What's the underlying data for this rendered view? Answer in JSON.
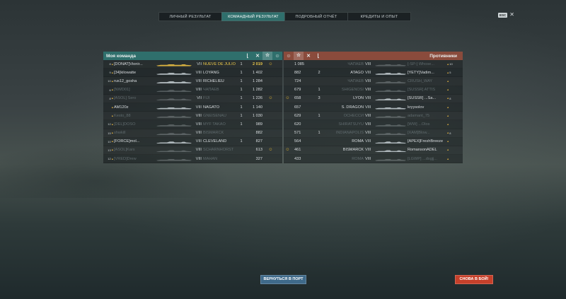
{
  "tabs": [
    "ЛИЧНЫЙ РЕЗУЛЬТАТ",
    "КОМАНДНЫЙ РЕЗУЛЬТАТ",
    "ПОДРОБНЫЙ ОТЧЁТ",
    "КРЕДИТЫ И ОПЫТ"
  ],
  "active_tab": 1,
  "esc_label": "ESC",
  "close_glyph": "✕",
  "ally_header": "Моя команда",
  "enemy_header": "Противники",
  "header_icons": {
    "kills": "✕",
    "xp": "☆",
    "medal": "☺",
    "sort": "⌊"
  },
  "ally_rows": [
    {
      "lvl": "8",
      "player": "[DONAT]Vionir...",
      "tier": "VII",
      "ship": "NUEVE DE JULIO",
      "kills": "1",
      "xp": "2 019",
      "medal": "☺",
      "dead": false,
      "highlight": true
    },
    {
      "lvl": "9",
      "player": "[34]kilowatte",
      "tier": "VIII",
      "ship": "LOYANG",
      "kills": "1",
      "xp": "1 402",
      "medal": "",
      "dead": false,
      "highlight": false
    },
    {
      "lvl": "10",
      "player": "rus12_gosha",
      "tier": "VIII",
      "ship": "RICHELIEU",
      "kills": "1",
      "xp": "1 284",
      "medal": "",
      "dead": false,
      "highlight": false
    },
    {
      "lvl": "6",
      "player": "[NWD01]",
      "tier": "VIII",
      "ship": "ЧАПАЕВ",
      "kills": "1",
      "xp": "1 282",
      "medal": "",
      "dead": true,
      "highlight": false
    },
    {
      "lvl": "8",
      "player": "[ASOL] Sero",
      "tier": "VII",
      "ship": "FIJI",
      "kills": "1",
      "xp": "1 226",
      "medal": "☺",
      "dead": true,
      "highlight": false
    },
    {
      "lvl": "",
      "player": "AM120z",
      "tier": "VIII",
      "ship": "NAGATO",
      "kills": "1",
      "xp": "1 140",
      "medal": "",
      "dead": false,
      "highlight": false
    },
    {
      "lvl": "",
      "player": "Kesto_88",
      "tier": "VIII",
      "ship": "GNEISENAU",
      "kills": "1",
      "xp": "1 030",
      "medal": "",
      "dead": true,
      "highlight": false
    },
    {
      "lvl": "12",
      "player": "[DEL]DOSO",
      "tier": "VIII",
      "ship": "MYF TAKAO",
      "kills": "1",
      "xp": "989",
      "medal": "",
      "dead": true,
      "highlight": false
    },
    {
      "lvl": "15",
      "player": "shwkill",
      "tier": "VIII",
      "ship": "BISMARCK",
      "kills": "",
      "xp": "882",
      "medal": "",
      "dead": true,
      "highlight": false
    },
    {
      "lvl": "10",
      "player": "[FORCE]mol...",
      "tier": "VIII",
      "ship": "CLEVELAND",
      "kills": "1",
      "xp": "827",
      "medal": "",
      "dead": false,
      "highlight": false
    },
    {
      "lvl": "13",
      "player": "[ASOL]Kars",
      "tier": "VIII",
      "ship": "SCHARNHORST",
      "kills": "",
      "xp": "613",
      "medal": "☺",
      "dead": true,
      "highlight": false
    },
    {
      "lvl": "12",
      "player": "[VRED]Drew",
      "tier": "VIII",
      "ship": "MAHAN",
      "kills": "",
      "xp": "327",
      "medal": "",
      "dead": true,
      "highlight": false
    }
  ],
  "enemy_rows": [
    {
      "medal": "",
      "xp": "1 085",
      "kills": "",
      "ship": "ЧАПАЕВ",
      "tier": "VIII",
      "player": "[-SP-] Whose...",
      "lvl": "10",
      "dead": true
    },
    {
      "medal": "",
      "xp": "882",
      "kills": "2",
      "ship": "ATAGO",
      "tier": "VIII",
      "player": "[YETY]Vadim...",
      "lvl": "5",
      "dead": false
    },
    {
      "medal": "",
      "xp": "724",
      "kills": "",
      "ship": "ЧАПАЕВ",
      "tier": "VIII",
      "player": "CRUSH_WAY",
      "lvl": "",
      "dead": true
    },
    {
      "medal": "",
      "xp": "679",
      "kills": "1",
      "ship": "SHIGENOSI",
      "tier": "VIII",
      "player": "[SUSSR] ATTIS",
      "lvl": "",
      "dead": true
    },
    {
      "medal": "☺",
      "xp": "658",
      "kills": "3",
      "ship": "LYON",
      "tier": "VIII",
      "player": "[SUSSR] ...Sa...",
      "lvl": "8",
      "dead": false
    },
    {
      "medal": "",
      "xp": "657",
      "kills": "",
      "ship": "S. DRAGON",
      "tier": "VIII",
      "player": "kryysolov",
      "lvl": "",
      "dead": false
    },
    {
      "medal": "",
      "xp": "629",
      "kills": "1",
      "ship": "ОСНЕССИ",
      "tier": "VIII",
      "player": "adamant_75",
      "lvl": "",
      "dead": true
    },
    {
      "medal": "",
      "xp": "620",
      "kills": "",
      "ship": "SHIRATSUYU",
      "tier": "VIII",
      "player": "[WW] ...Olos",
      "lvl": "",
      "dead": true
    },
    {
      "medal": "",
      "xp": "571",
      "kills": "1",
      "ship": "INDIANAPOLIS",
      "tier": "VIII",
      "player": "[XAM]Blow...",
      "lvl": "8",
      "dead": true
    },
    {
      "medal": "",
      "xp": "564",
      "kills": "",
      "ship": "ROMA",
      "tier": "VIII",
      "player": "[APEX]FreshBreeze",
      "lvl": "",
      "dead": false
    },
    {
      "medal": "☺",
      "xp": "461",
      "kills": "",
      "ship": "BISMARCK",
      "tier": "VIII",
      "player": "RomansonADEL",
      "lvl": "",
      "dead": false
    },
    {
      "medal": "",
      "xp": "433",
      "kills": "",
      "ship": "ROMA",
      "tier": "VIII",
      "player": "[LGWP] ...dsgjj...",
      "lvl": "",
      "dead": true
    }
  ],
  "buttons": {
    "port": "ВЕРНУТЬСЯ В ПОРТ",
    "battle": "СНОВА В БОЙ!"
  }
}
